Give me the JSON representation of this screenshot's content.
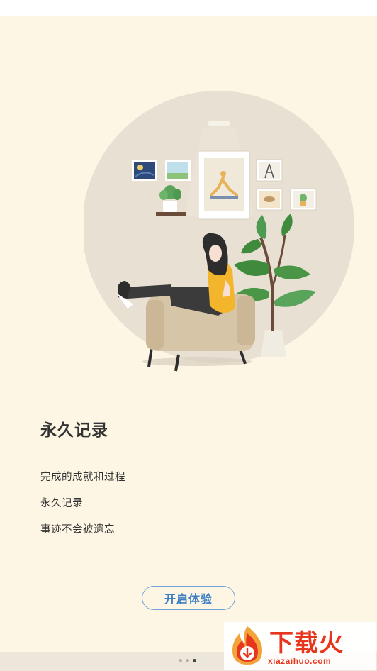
{
  "onboarding": {
    "title": "永久记录",
    "lines": [
      "完成的成就和过程",
      "永久记录",
      "事迹不会被遗忘"
    ],
    "start_button": "开启体验",
    "page_indicator": {
      "total": 3,
      "current": 3
    }
  },
  "watermark": {
    "brand": "下载火",
    "url": "xiazaihuo.com"
  },
  "colors": {
    "background": "#fdf6e4",
    "button_border": "#6fa2d6",
    "button_text": "#3e7fc4",
    "watermark": "#e8361e"
  }
}
